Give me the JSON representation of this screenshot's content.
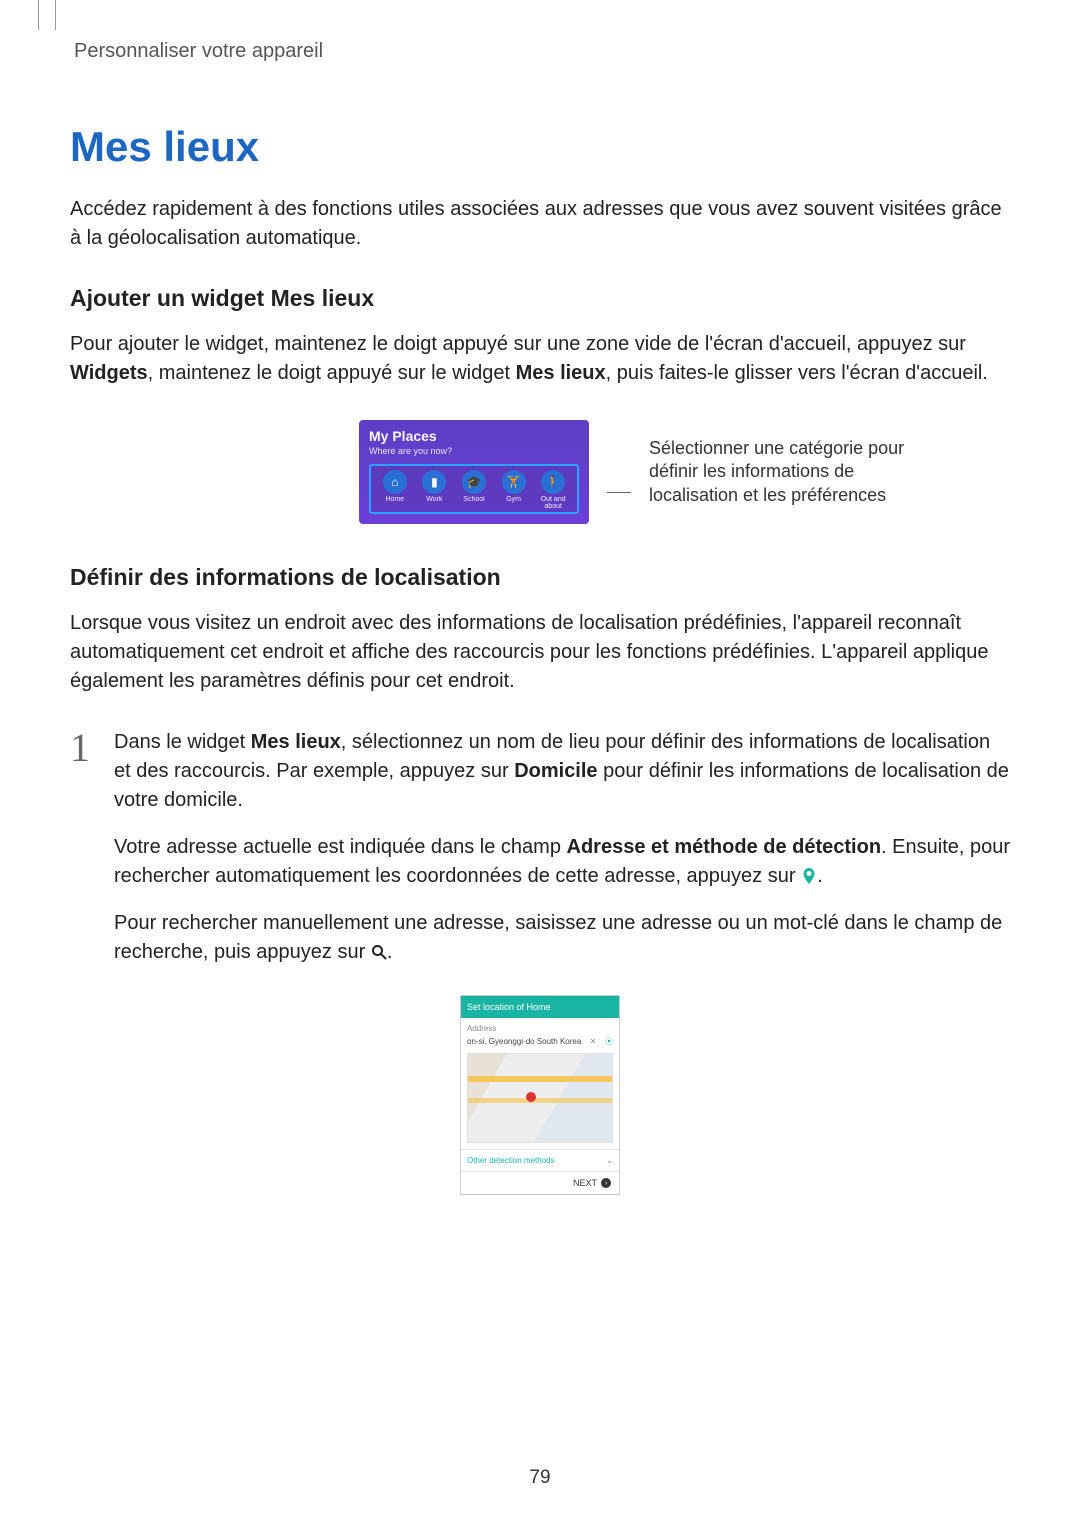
{
  "running_head": "Personnaliser votre appareil",
  "title": "Mes lieux",
  "intro": "Accédez rapidement à des fonctions utiles associées aux adresses que vous avez souvent visitées grâce à la géolocalisation automatique.",
  "sub1": "Ajouter un widget Mes lieux",
  "p1a": "Pour ajouter le widget, maintenez le doigt appuyé sur une zone vide de l'écran d'accueil, appuyez sur ",
  "p1b": "Widgets",
  "p1c": ", maintenez le doigt appuyé sur le widget ",
  "p1d": "Mes lieux",
  "p1e": ", puis faites-le glisser vers l'écran d'accueil.",
  "widget": {
    "title": "My Places",
    "sub": "Where are you now?",
    "items": [
      {
        "label": "Home"
      },
      {
        "label": "Work"
      },
      {
        "label": "School"
      },
      {
        "label": "Gym"
      },
      {
        "label": "Out and about"
      }
    ]
  },
  "callout": "Sélectionner une catégorie pour définir les informations de localisation et les préférences",
  "sub2": "Définir des informations de localisation",
  "p2": "Lorsque vous visitez un endroit avec des informations de localisation prédéfinies, l'appareil reconnaît automatiquement cet endroit et affiche des raccourcis pour les fonctions prédéfinies. L'appareil applique également les paramètres définis pour cet endroit.",
  "step1": {
    "num": "1",
    "a": "Dans le widget ",
    "b": "Mes lieux",
    "c": ", sélectionnez un nom de lieu pour définir des informations de localisation et des raccourcis. Par exemple, appuyez sur ",
    "d": "Domicile",
    "e": " pour définir les informations de localisation de votre domicile.",
    "p2a": "Votre adresse actuelle est indiquée dans le champ ",
    "p2b": "Adresse et méthode de détection",
    "p2c": ". Ensuite, pour rechercher automatiquement les coordonnées de cette adresse, appuyez sur ",
    "p2d": ".",
    "p3a": "Pour rechercher manuellement une adresse, saisissez une adresse ou un mot-clé dans le champ de recherche, puis appuyez sur ",
    "p3b": "."
  },
  "phone": {
    "header": "Set location of Home",
    "addr_label": "Address",
    "addr": "on-si, Gyeonggi-do South Korea",
    "other": "Other detection methods",
    "next": "NEXT"
  },
  "page_number": "79"
}
